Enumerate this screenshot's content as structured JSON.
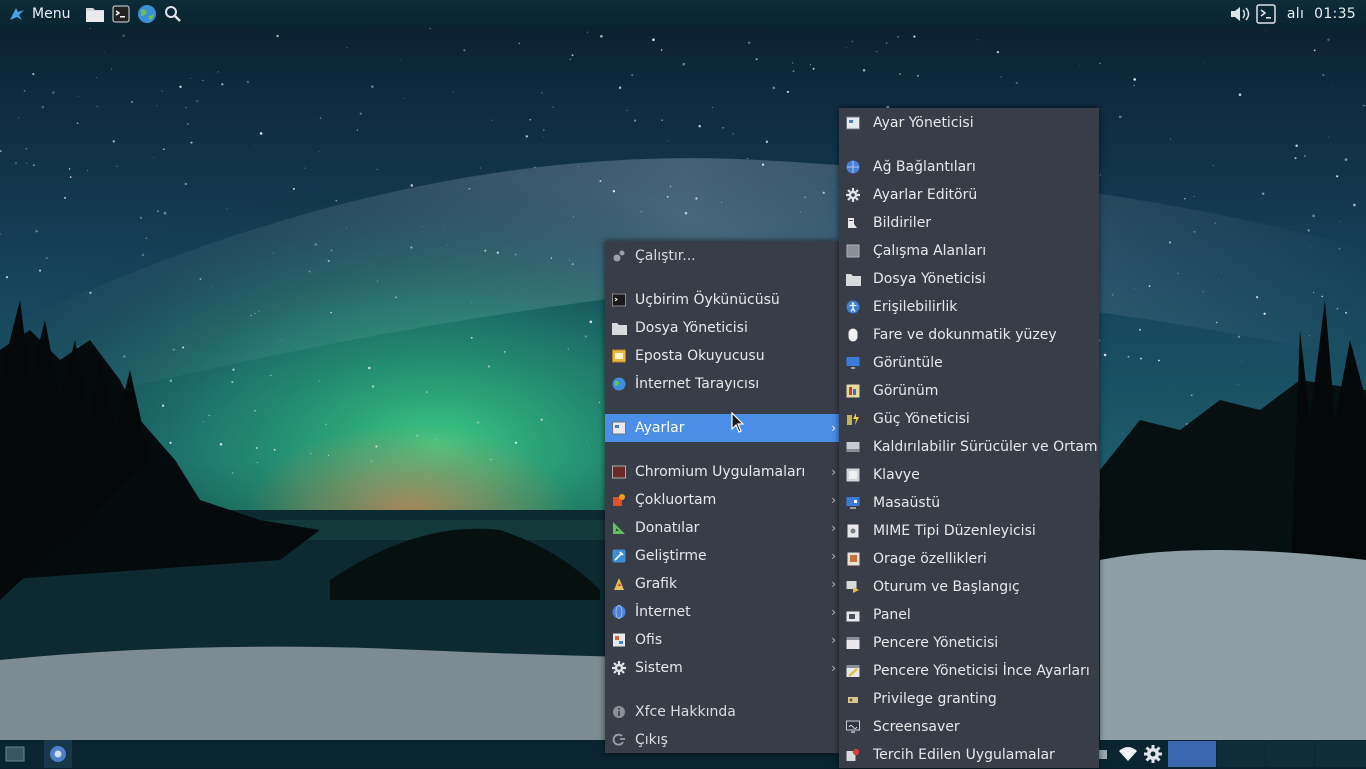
{
  "top_panel": {
    "menu_label": "Menu",
    "launchers": [
      "file-manager",
      "terminal",
      "web-browser",
      "app-finder"
    ],
    "day": "alı",
    "time": "01:35"
  },
  "main_menu": {
    "items": [
      {
        "label": "Çalıştır...",
        "icon": "run-icon"
      },
      {
        "label": "Uçbirim Öykünücüsü",
        "icon": "terminal-icon"
      },
      {
        "label": "Dosya Yöneticisi",
        "icon": "folder-icon"
      },
      {
        "label": "Eposta Okuyucusu",
        "icon": "mail-icon"
      },
      {
        "label": "İnternet Tarayıcısı",
        "icon": "globe-icon"
      },
      {
        "label": "Ayarlar",
        "icon": "settings-icon"
      },
      {
        "label": "Chromium Uygulamaları",
        "icon": "chromium-apps-icon"
      },
      {
        "label": "Çokluortam",
        "icon": "multimedia-icon"
      },
      {
        "label": "Donatılar",
        "icon": "accessories-icon"
      },
      {
        "label": "Geliştirme",
        "icon": "development-icon"
      },
      {
        "label": "Grafik",
        "icon": "graphics-icon"
      },
      {
        "label": "İnternet",
        "icon": "internet-icon"
      },
      {
        "label": "Ofis",
        "icon": "office-icon"
      },
      {
        "label": "Sistem",
        "icon": "system-gear-icon"
      },
      {
        "label": "Xfce Hakkında",
        "icon": "info-icon"
      },
      {
        "label": "Çıkış",
        "icon": "logout-icon"
      }
    ]
  },
  "sub_menu": {
    "items": [
      {
        "label": "Ayar Yöneticisi",
        "icon": "settings-manager-icon"
      },
      {
        "label": "Ağ Bağlantıları",
        "icon": "network-icon"
      },
      {
        "label": "Ayarlar Editörü",
        "icon": "gear-icon"
      },
      {
        "label": "Bildiriler",
        "icon": "notifications-icon"
      },
      {
        "label": "Çalışma Alanları",
        "icon": "workspaces-icon"
      },
      {
        "label": "Dosya Yöneticisi",
        "icon": "folder-icon"
      },
      {
        "label": "Erişilebilirlik",
        "icon": "accessibility-icon"
      },
      {
        "label": "Fare ve dokunmatik yüzey",
        "icon": "mouse-icon"
      },
      {
        "label": "Görüntüle",
        "icon": "display-icon"
      },
      {
        "label": "Görünüm",
        "icon": "appearance-icon"
      },
      {
        "label": "Güç Yöneticisi",
        "icon": "power-manager-icon"
      },
      {
        "label": "Kaldırılabilir Sürücüler ve Ortam",
        "icon": "removable-drive-icon"
      },
      {
        "label": "Klavye",
        "icon": "keyboard-icon"
      },
      {
        "label": "Masaüstü",
        "icon": "desktop-icon"
      },
      {
        "label": "MIME Tipi Düzenleyicisi",
        "icon": "mime-icon"
      },
      {
        "label": "Orage özellikleri",
        "icon": "calendar-icon"
      },
      {
        "label": "Oturum ve Başlangıç",
        "icon": "session-icon"
      },
      {
        "label": "Panel",
        "icon": "panel-icon"
      },
      {
        "label": "Pencere Yöneticisi",
        "icon": "window-manager-icon"
      },
      {
        "label": "Pencere Yöneticisi İnce Ayarları",
        "icon": "window-tweaks-icon"
      },
      {
        "label": "Privilege granting",
        "icon": "privilege-icon"
      },
      {
        "label": "Screensaver",
        "icon": "screensaver-icon"
      },
      {
        "label": "Tercih Edilen Uygulamalar",
        "icon": "preferred-apps-icon"
      }
    ]
  },
  "colors": {
    "highlight": "#4a8ee8",
    "menu_bg": "#393d47",
    "panel_bg": "#0a2530",
    "active_workspace": "#3a67b0"
  }
}
